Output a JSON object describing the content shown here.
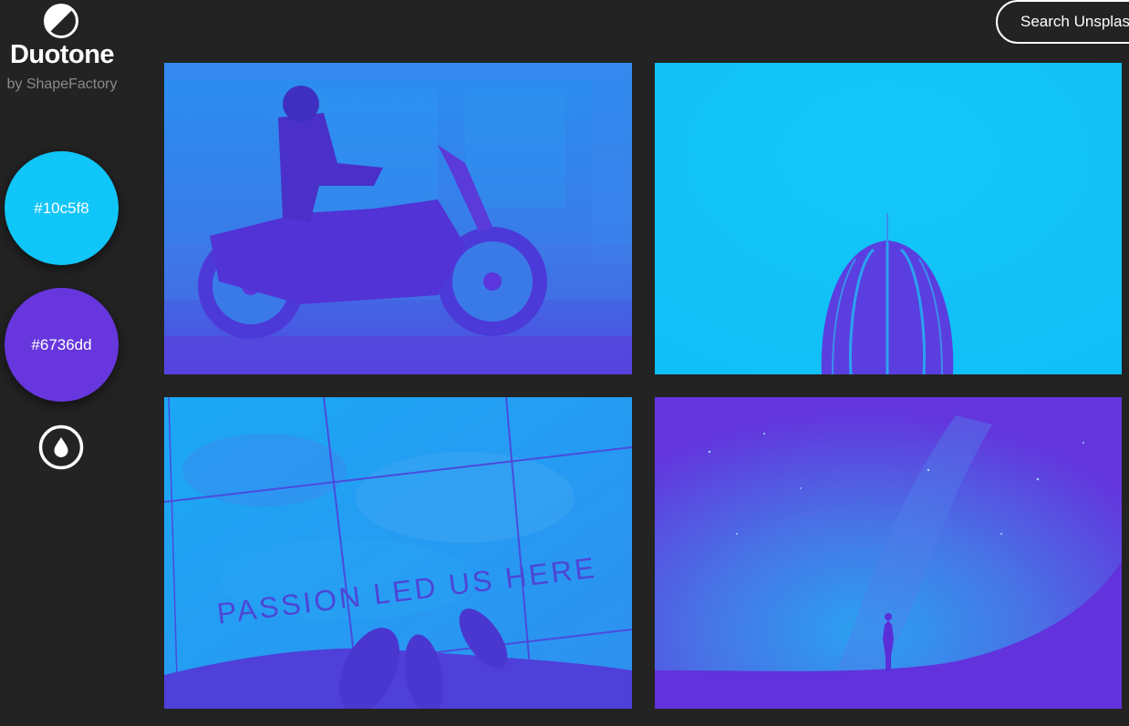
{
  "app": {
    "title": "Duotone",
    "byline": "by ShapeFactory"
  },
  "colors": {
    "background": "#232323",
    "highlight": "#10c5f8",
    "shadow": "#6736dd"
  },
  "swatches": [
    {
      "label": "#10c5f8",
      "color": "#10c5f8"
    },
    {
      "label": "#6736dd",
      "color": "#6736dd"
    }
  ],
  "icons": {
    "logo": "half-circle-contrast-icon",
    "randomize": "water-drop-icon"
  },
  "search": {
    "label": "Search Unsplash"
  },
  "photos": [
    {
      "subject": "motorcycle-rider"
    },
    {
      "subject": "cactus"
    },
    {
      "subject": "sidewalk-passion",
      "sign_text": "PASSION LED US HERE"
    },
    {
      "subject": "milky-way-silhouette"
    }
  ]
}
